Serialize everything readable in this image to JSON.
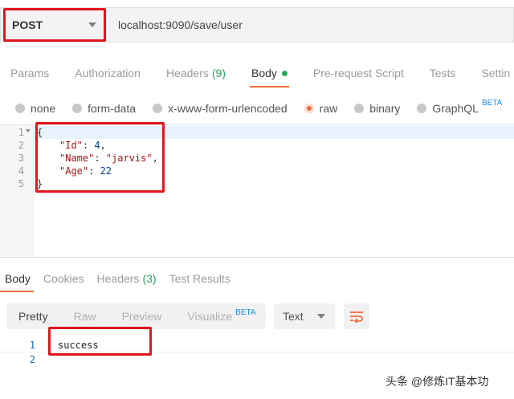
{
  "request": {
    "method": "POST",
    "url": "localhost:9090/save/user"
  },
  "request_tabs": [
    {
      "label": "Params"
    },
    {
      "label": "Authorization"
    },
    {
      "label": "Headers",
      "count": "(9)"
    },
    {
      "label": "Body"
    },
    {
      "label": "Pre-request Script"
    },
    {
      "label": "Tests"
    },
    {
      "label": "Settin"
    }
  ],
  "body_types": [
    {
      "label": "none"
    },
    {
      "label": "form-data"
    },
    {
      "label": "x-www-form-urlencoded"
    },
    {
      "label": "raw"
    },
    {
      "label": "binary"
    },
    {
      "label": "GraphQL",
      "badge": "BETA"
    }
  ],
  "editor": {
    "line_numbers": [
      "1",
      "2",
      "3",
      "4",
      "5"
    ],
    "lines": {
      "l1": "{",
      "l2_key": "\"Id\"",
      "l2_sep": ": ",
      "l2_val": "4",
      "l2_end": ",",
      "l3_key": "\"Name\"",
      "l3_sep": ": ",
      "l3_val": "\"jarvis\"",
      "l3_end": ",",
      "l4_key": "\"Age\"",
      "l4_sep": ": ",
      "l4_val": "22",
      "l5": "}"
    }
  },
  "response_tabs": [
    {
      "label": "Body"
    },
    {
      "label": "Cookies"
    },
    {
      "label": "Headers",
      "count": "(3)"
    },
    {
      "label": "Test Results"
    }
  ],
  "view_modes": [
    {
      "label": "Pretty"
    },
    {
      "label": "Raw"
    },
    {
      "label": "Preview"
    },
    {
      "label": "Visualize",
      "badge": "BETA"
    }
  ],
  "format": "Text",
  "response": {
    "line_numbers": [
      "1",
      "2"
    ],
    "line1": "success"
  },
  "watermark": "头条 @修炼IT基本功",
  "colors": {
    "accent": "#f26b3a",
    "green": "#26a65b",
    "annotation_red": "#e0161e",
    "beta_blue": "#1e88e5"
  }
}
